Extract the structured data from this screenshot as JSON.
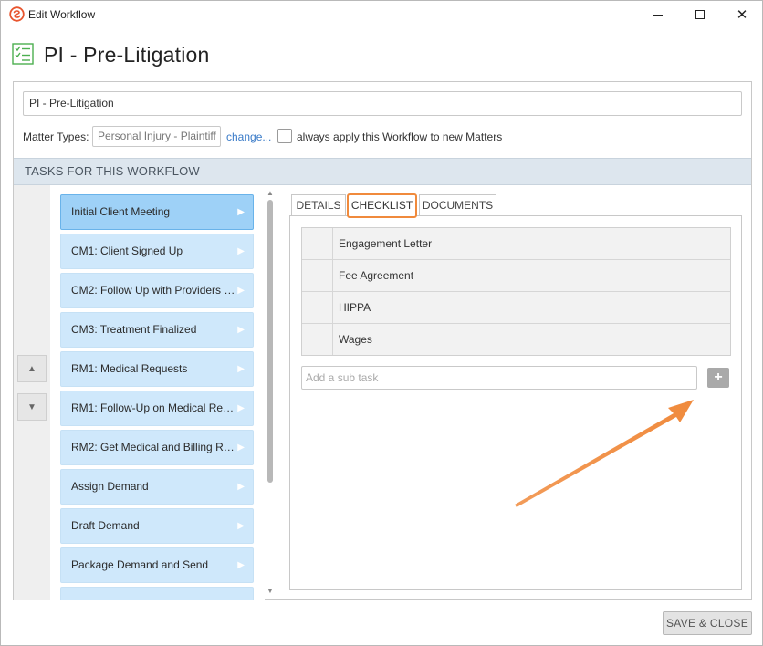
{
  "window": {
    "title": "Edit Workflow",
    "minimize_icon": "minimize-icon",
    "maximize_icon": "maximize-icon",
    "close_icon": "close-icon",
    "close_glyph": "✕"
  },
  "header": {
    "title": "PI - Pre-Litigation",
    "icon": "checklist-icon"
  },
  "form": {
    "name_value": "PI - Pre-Litigation",
    "matter_types_label": "Matter Types:",
    "matter_types_value": "Personal Injury - Plaintiff",
    "change_link": "change...",
    "always_apply_label": "always apply this Workflow to new Matters",
    "always_apply_checked": false
  },
  "tasks_section": {
    "title": "TASKS FOR THIS WORKFLOW",
    "move_up_glyph": "▲",
    "move_down_glyph": "▼",
    "items": [
      {
        "label": "Initial Client Meeting",
        "active": true
      },
      {
        "label": "CM1: Client Signed Up",
        "active": false
      },
      {
        "label": "CM2: Follow Up with Providers a...",
        "active": false
      },
      {
        "label": "CM3: Treatment Finalized",
        "active": false
      },
      {
        "label": "RM1: Medical Requests",
        "active": false
      },
      {
        "label": "RM1: Follow-Up on Medical Req...",
        "active": false
      },
      {
        "label": "RM2: Get Medical and Billing Re...",
        "active": false
      },
      {
        "label": "Assign Demand",
        "active": false
      },
      {
        "label": "Draft Demand",
        "active": false
      },
      {
        "label": "Package Demand and Send",
        "active": false
      },
      {
        "label": "",
        "active": false
      }
    ],
    "item_chevron": "▶"
  },
  "tabs": {
    "details": "DETAILS",
    "checklist": "CHECKLIST",
    "documents": "DOCUMENTS",
    "selected": "CHECKLIST"
  },
  "checklist": {
    "items": [
      "Engagement Letter",
      "Fee Agreement",
      "HIPPA",
      "Wages"
    ],
    "add_placeholder": "Add a sub task",
    "add_button_glyph": "+"
  },
  "footer": {
    "save_close": "SAVE & CLOSE"
  },
  "colors": {
    "accent_orange": "#f08a3c",
    "task_bg": "#cfe8fb",
    "task_active_bg": "#9ed1f7",
    "section_bar": "#dde6ee",
    "link_blue": "#3a7bc8"
  }
}
